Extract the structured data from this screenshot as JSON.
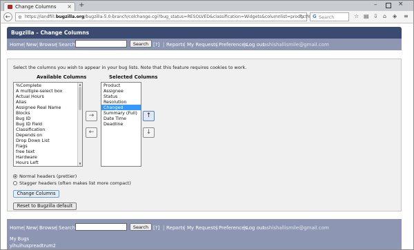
{
  "browser": {
    "tab_title": "Change Columns",
    "new_tab": "+",
    "url_prefix": "https://landfill.",
    "url_domain": "bugzilla.org",
    "url_rest": "/bugzilla-5.0-branch/colchange.cgi?bug_status=RESOLVED&classification=Widgets&columnlist=product%2Cc",
    "search_placeholder": "Search",
    "search_engine": "G"
  },
  "bugzilla": {
    "header_title": "Bugzilla – Change Columns",
    "nav": {
      "home": "Home",
      "new": "New",
      "browse": "Browse",
      "search": "Search",
      "search_button": "Search",
      "help": "[?]",
      "reports": "Reports",
      "my_requests": "My Requests",
      "preferences": "Preferences",
      "logout": "Log out",
      "user_email": "ashishallismile@gmail.com",
      "separator": "|"
    },
    "intro_text": "Select the columns you wish to appear in your bug lists. Note that this feature requires cookies to work.",
    "available_title": "Available Columns",
    "selected_title": "Selected Columns",
    "available_columns": [
      "%Complete",
      "A multiple-select box",
      "Actual Hours",
      "Alias",
      "Assignee Real Name",
      "Blocks",
      "Bug ID",
      "Bug ID Field",
      "Classification",
      "Depends on",
      "Drop Down List",
      "Flags",
      "free text",
      "Hardware",
      "Hours Left"
    ],
    "selected_columns": [
      "Product",
      "Assignee",
      "Status",
      "Resolution",
      "Changed",
      "Summary (Full)",
      "Date Time",
      "Deadline"
    ],
    "selected_highlight": "Changed",
    "move_right": "→",
    "move_left": "←",
    "move_up": "↑",
    "move_down": "↓",
    "radio_normal": "Normal headers (prettier)",
    "radio_stagger": "Stagger headers (often makes list more compact)",
    "header_style_selected": "normal",
    "change_columns_button": "Change Columns",
    "reset_button": "Reset to Bugzilla default",
    "footer": {
      "my_bugs": "My Bugs",
      "saved_search": "yihuihuspreadtrum2"
    }
  }
}
